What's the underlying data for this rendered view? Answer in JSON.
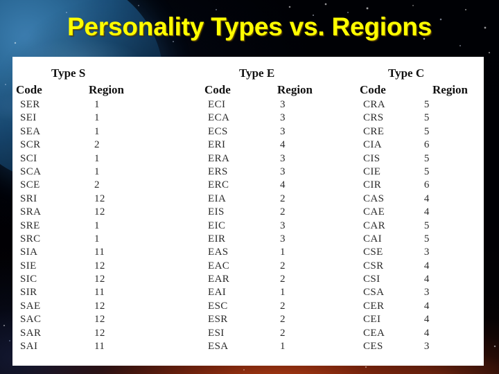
{
  "slide": {
    "title": "Personality Types vs. Regions",
    "title_color": "#FFFF00",
    "background_color": "#000000",
    "panel_color": "#FFFFFF"
  },
  "table": {
    "headers": {
      "code": "Code",
      "region": "Region"
    },
    "groups": [
      {
        "title": "Type S",
        "rows": [
          {
            "code": "SER",
            "region": "1"
          },
          {
            "code": "SEI",
            "region": "1"
          },
          {
            "code": "SEA",
            "region": "1"
          },
          {
            "code": "SCR",
            "region": "2"
          },
          {
            "code": "SCI",
            "region": "1"
          },
          {
            "code": "SCA",
            "region": "1"
          },
          {
            "code": "SCE",
            "region": "2"
          },
          {
            "code": "SRI",
            "region": "12"
          },
          {
            "code": "SRA",
            "region": "12"
          },
          {
            "code": "SRE",
            "region": "1"
          },
          {
            "code": "SRC",
            "region": "1"
          },
          {
            "code": "SIA",
            "region": "11"
          },
          {
            "code": "SIE",
            "region": "12"
          },
          {
            "code": "SIC",
            "region": "12"
          },
          {
            "code": "SIR",
            "region": "11"
          },
          {
            "code": "SAE",
            "region": "12"
          },
          {
            "code": "SAC",
            "region": "12"
          },
          {
            "code": "SAR",
            "region": "12"
          },
          {
            "code": "SAI",
            "region": "11"
          }
        ]
      },
      {
        "title": "Type E",
        "rows": [
          {
            "code": "ECI",
            "region": "3"
          },
          {
            "code": "ECA",
            "region": "3"
          },
          {
            "code": "ECS",
            "region": "3"
          },
          {
            "code": "ERI",
            "region": "4"
          },
          {
            "code": "ERA",
            "region": "3"
          },
          {
            "code": "ERS",
            "region": "3"
          },
          {
            "code": "ERC",
            "region": "4"
          },
          {
            "code": "EIA",
            "region": "2"
          },
          {
            "code": "EIS",
            "region": "2"
          },
          {
            "code": "EIC",
            "region": "3"
          },
          {
            "code": "EIR",
            "region": "3"
          },
          {
            "code": "EAS",
            "region": "1"
          },
          {
            "code": "EAC",
            "region": "2"
          },
          {
            "code": "EAR",
            "region": "2"
          },
          {
            "code": "EAI",
            "region": "1"
          },
          {
            "code": "ESC",
            "region": "2"
          },
          {
            "code": "ESR",
            "region": "2"
          },
          {
            "code": "ESI",
            "region": "2"
          },
          {
            "code": "ESA",
            "region": "1"
          }
        ]
      },
      {
        "title": "Type C",
        "rows": [
          {
            "code": "CRA",
            "region": "5"
          },
          {
            "code": "CRS",
            "region": "5"
          },
          {
            "code": "CRE",
            "region": "5"
          },
          {
            "code": "CIA",
            "region": "6"
          },
          {
            "code": "CIS",
            "region": "5"
          },
          {
            "code": "CIE",
            "region": "5"
          },
          {
            "code": "CIR",
            "region": "6"
          },
          {
            "code": "CAS",
            "region": "4"
          },
          {
            "code": "CAE",
            "region": "4"
          },
          {
            "code": "CAR",
            "region": "5"
          },
          {
            "code": "CAI",
            "region": "5"
          },
          {
            "code": "CSE",
            "region": "3"
          },
          {
            "code": "CSR",
            "region": "4"
          },
          {
            "code": "CSI",
            "region": "4"
          },
          {
            "code": "CSA",
            "region": "3"
          },
          {
            "code": "CER",
            "region": "4"
          },
          {
            "code": "CEI",
            "region": "4"
          },
          {
            "code": "CEA",
            "region": "4"
          },
          {
            "code": "CES",
            "region": "3"
          }
        ]
      }
    ]
  }
}
